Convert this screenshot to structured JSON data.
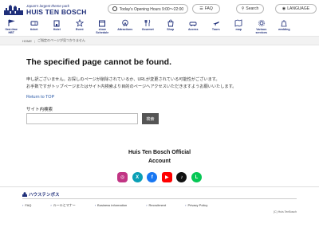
{
  "header": {
    "logo_sub": "Japan's largest theme park",
    "logo_main": "HUIS TEN BOSCH",
    "hours": "Today's Opening Hours 9:00～22:00",
    "faq_label": "FAQ",
    "search_label": "Search",
    "language_label": "LANGUAGE"
  },
  "nav": {
    "items": [
      {
        "label": "first-time\nHBT",
        "icon": "flag-icon"
      },
      {
        "label": "ticket",
        "icon": "ticket-icon"
      },
      {
        "label": "Hotel",
        "icon": "hotel-icon"
      },
      {
        "label": "Event",
        "icon": "event-icon"
      },
      {
        "label": "show\nSchedule",
        "icon": "schedule-icon"
      },
      {
        "label": "Attractions",
        "icon": "attractions-icon"
      },
      {
        "label": "Gourmet",
        "icon": "gourmet-icon"
      },
      {
        "label": "Shop",
        "icon": "shop-icon"
      },
      {
        "label": "Access",
        "icon": "access-icon"
      },
      {
        "label": "Tours",
        "icon": "tours-icon"
      },
      {
        "label": "map",
        "icon": "map-icon"
      },
      {
        "label": "Various\nservices",
        "icon": "services-icon"
      },
      {
        "label": "wedding",
        "icon": "wedding-icon"
      }
    ]
  },
  "breadcrumb": {
    "home": "HOME",
    "current": "ご指定のページが見つかりません"
  },
  "main": {
    "title": "The specified page cannot be found.",
    "body1": "申し訳ございません。お探しのページが削除されているか、URLが変更されている可能性がございます。",
    "body2": "お手数ですがトップページまたはサイト内検索より目的のページへアクセスいただきますようお願いいたします。",
    "return_link": "Return to TOP",
    "search_label": "サイト内検索",
    "search_placeholder": "",
    "search_button": "検索"
  },
  "official": {
    "line1": "Huis Ten Bosch Official",
    "line2": "Account"
  },
  "socials": [
    {
      "name": "instagram-icon",
      "color": "#c13584",
      "glyph": "◎"
    },
    {
      "name": "x-icon",
      "color": "#0a9fb5",
      "glyph": "X"
    },
    {
      "name": "facebook-icon",
      "color": "#1877f2",
      "glyph": "f"
    },
    {
      "name": "youtube-icon",
      "color": "#ff0000",
      "glyph": "▶"
    },
    {
      "name": "tiktok-icon",
      "color": "#111111",
      "glyph": "♪"
    },
    {
      "name": "line-icon",
      "color": "#06c755",
      "glyph": "L"
    }
  ],
  "footer": {
    "logo_text": "ハウステンボス",
    "links": [
      "FAQ",
      "ルールとマナー",
      "Business information",
      "Recruitment",
      "Privacy Policy"
    ],
    "copyright": "(C) Huis TenBosch"
  },
  "colors": {
    "brand": "#1f2f7a",
    "link": "#2b5aa8",
    "search_button": "#555555"
  }
}
